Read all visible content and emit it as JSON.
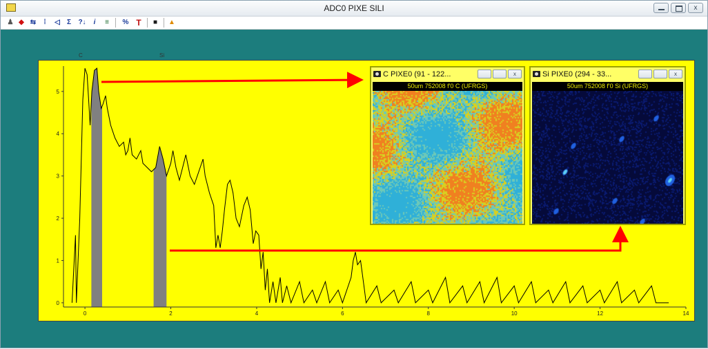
{
  "window": {
    "title": "ADC0 PIXE SILI",
    "minimize_glyph": "",
    "maximize_glyph": "",
    "close_glyph": "x"
  },
  "toolbar": {
    "items": [
      {
        "name": "zoom-icon",
        "glyph": "♟",
        "color": "#555555"
      },
      {
        "name": "arrows-icon",
        "glyph": "◆",
        "color": "#d01010"
      },
      {
        "name": "back-icon",
        "glyph": "⇆",
        "color": "#1a3a9a"
      },
      {
        "name": "lin-log-icon",
        "glyph": "⁞",
        "color": "#1a3a9a"
      },
      {
        "name": "marker-icon",
        "glyph": "◁",
        "color": "#1a3a9a"
      },
      {
        "name": "sum-icon",
        "glyph": "Σ",
        "color": "#1a3a9a"
      },
      {
        "name": "question-icon",
        "glyph": "?↓",
        "color": "#1a3a9a"
      },
      {
        "name": "info-icon",
        "glyph": "i",
        "color": "#1a3a9a"
      },
      {
        "name": "list-icon",
        "glyph": "≡",
        "color": "#1a6a2a"
      },
      {
        "name": "percent-icon",
        "glyph": "%",
        "color": "#1a3a9a"
      },
      {
        "name": "text-icon",
        "glyph": "T",
        "color": "#c01010"
      },
      {
        "name": "window-icon",
        "glyph": "■",
        "color": "#1a1a1a"
      },
      {
        "name": "warning-icon",
        "glyph": "▲",
        "color": "#e08a00"
      }
    ]
  },
  "colors": {
    "background": "#1c7d7d",
    "plot_background": "#ffff00",
    "spectrum_line": "#000000",
    "peak_fill": "#808080",
    "arrow": "#ff0000"
  },
  "peak_labels": {
    "c": "C",
    "si": "Si"
  },
  "chart_data": {
    "type": "line",
    "xlabel": "",
    "ylabel": "",
    "xlim": [
      -0.5,
      14
    ],
    "ylim": [
      -0.1,
      5.6
    ],
    "x_ticks": [
      0,
      2,
      4,
      6,
      8,
      10,
      12,
      14
    ],
    "x_tick_labels": [
      "0",
      "2",
      "4",
      "6",
      "8",
      "10",
      "12",
      "14"
    ],
    "y_ticks": [
      0,
      1,
      2,
      3,
      4,
      5
    ],
    "y_tick_labels": [
      "0",
      "1",
      "2",
      "3",
      "4",
      "5"
    ],
    "scale": "log",
    "peaks": [
      {
        "label": "C",
        "x": 0.28
      },
      {
        "label": "Si",
        "x": 1.74
      }
    ],
    "highlighted_regions": [
      {
        "label": "C",
        "x_start": 0.15,
        "x_end": 0.4
      },
      {
        "label": "Si",
        "x_start": 1.6,
        "x_end": 1.9
      }
    ],
    "series": [
      {
        "values": [
          [
            -0.3,
            0
          ],
          [
            -0.22,
            1.6
          ],
          [
            -0.2,
            0
          ],
          [
            -0.12,
            2.0
          ],
          [
            -0.05,
            4.8
          ],
          [
            0.0,
            5.55
          ],
          [
            0.05,
            5.4
          ],
          [
            0.08,
            4.9
          ],
          [
            0.12,
            4.2
          ],
          [
            0.16,
            5.0
          ],
          [
            0.22,
            5.5
          ],
          [
            0.28,
            5.55
          ],
          [
            0.32,
            5.0
          ],
          [
            0.38,
            4.6
          ],
          [
            0.42,
            4.7
          ],
          [
            0.48,
            4.9
          ],
          [
            0.52,
            4.6
          ],
          [
            0.6,
            4.2
          ],
          [
            0.7,
            3.9
          ],
          [
            0.8,
            3.7
          ],
          [
            0.9,
            3.8
          ],
          [
            0.95,
            3.5
          ],
          [
            1.0,
            3.6
          ],
          [
            1.05,
            3.9
          ],
          [
            1.1,
            3.5
          ],
          [
            1.2,
            3.4
          ],
          [
            1.3,
            3.6
          ],
          [
            1.35,
            3.3
          ],
          [
            1.45,
            3.2
          ],
          [
            1.55,
            3.1
          ],
          [
            1.65,
            3.2
          ],
          [
            1.74,
            3.7
          ],
          [
            1.82,
            3.4
          ],
          [
            1.9,
            3.0
          ],
          [
            2.0,
            3.3
          ],
          [
            2.05,
            3.6
          ],
          [
            2.12,
            3.2
          ],
          [
            2.2,
            2.9
          ],
          [
            2.3,
            3.3
          ],
          [
            2.35,
            3.5
          ],
          [
            2.45,
            3.0
          ],
          [
            2.55,
            2.8
          ],
          [
            2.65,
            3.1
          ],
          [
            2.75,
            3.4
          ],
          [
            2.8,
            3.0
          ],
          [
            2.9,
            2.6
          ],
          [
            3.0,
            2.3
          ],
          [
            3.05,
            1.3
          ],
          [
            3.1,
            1.6
          ],
          [
            3.15,
            1.3
          ],
          [
            3.2,
            1.7
          ],
          [
            3.25,
            2.2
          ],
          [
            3.32,
            2.8
          ],
          [
            3.38,
            2.9
          ],
          [
            3.45,
            2.6
          ],
          [
            3.52,
            2.0
          ],
          [
            3.6,
            1.8
          ],
          [
            3.7,
            2.3
          ],
          [
            3.78,
            2.5
          ],
          [
            3.85,
            2.2
          ],
          [
            3.92,
            1.4
          ],
          [
            3.98,
            1.7
          ],
          [
            4.05,
            1.6
          ],
          [
            4.1,
            0.8
          ],
          [
            4.15,
            1.2
          ],
          [
            4.2,
            0.3
          ],
          [
            4.25,
            0.8
          ],
          [
            4.3,
            0
          ],
          [
            4.38,
            0.5
          ],
          [
            4.45,
            0
          ],
          [
            4.55,
            0.6
          ],
          [
            4.6,
            0
          ],
          [
            4.7,
            0.4
          ],
          [
            4.8,
            0
          ],
          [
            5.0,
            0.5
          ],
          [
            5.1,
            0
          ],
          [
            5.3,
            0.3
          ],
          [
            5.4,
            0
          ],
          [
            5.6,
            0.5
          ],
          [
            5.7,
            0
          ],
          [
            5.9,
            0.3
          ],
          [
            6.0,
            0
          ],
          [
            6.2,
            0.6
          ],
          [
            6.25,
            1.0
          ],
          [
            6.3,
            1.2
          ],
          [
            6.35,
            0.9
          ],
          [
            6.42,
            1.0
          ],
          [
            6.5,
            0.4
          ],
          [
            6.55,
            0
          ],
          [
            6.8,
            0.4
          ],
          [
            6.9,
            0
          ],
          [
            7.2,
            0.3
          ],
          [
            7.3,
            0
          ],
          [
            7.6,
            0.5
          ],
          [
            7.7,
            0
          ],
          [
            8.0,
            0.3
          ],
          [
            8.1,
            0
          ],
          [
            8.4,
            0.6
          ],
          [
            8.5,
            0
          ],
          [
            8.8,
            0.4
          ],
          [
            8.9,
            0
          ],
          [
            9.2,
            0.5
          ],
          [
            9.3,
            0
          ],
          [
            9.6,
            0.6
          ],
          [
            9.7,
            0
          ],
          [
            10.0,
            0.4
          ],
          [
            10.1,
            0
          ],
          [
            10.4,
            0.5
          ],
          [
            10.5,
            0
          ],
          [
            10.8,
            0.3
          ],
          [
            10.9,
            0
          ],
          [
            11.2,
            0.5
          ],
          [
            11.3,
            0
          ],
          [
            11.6,
            0.4
          ],
          [
            11.7,
            0
          ],
          [
            12.0,
            0.3
          ],
          [
            12.1,
            0
          ],
          [
            12.4,
            0.5
          ],
          [
            12.5,
            0
          ],
          [
            12.8,
            0.3
          ],
          [
            12.9,
            0
          ],
          [
            13.2,
            0.4
          ],
          [
            13.3,
            0
          ],
          [
            13.6,
            0
          ]
        ]
      }
    ]
  },
  "subwindows": [
    {
      "title": "C PIXE0  (91 - 122...",
      "label": "50um   752008 f'0   C  (UFRGS)",
      "map_colors": [
        "#2fb0d8",
        "#6cc8b8",
        "#d8d020",
        "#f08020"
      ]
    },
    {
      "title": "Si PIXE0  (294 - 33...",
      "label": "50um   752008 f'0   Si  (UFRGS)",
      "map_colors": [
        "#050a3a",
        "#0a1a70",
        "#2060e0",
        "#60d0f0"
      ]
    }
  ]
}
